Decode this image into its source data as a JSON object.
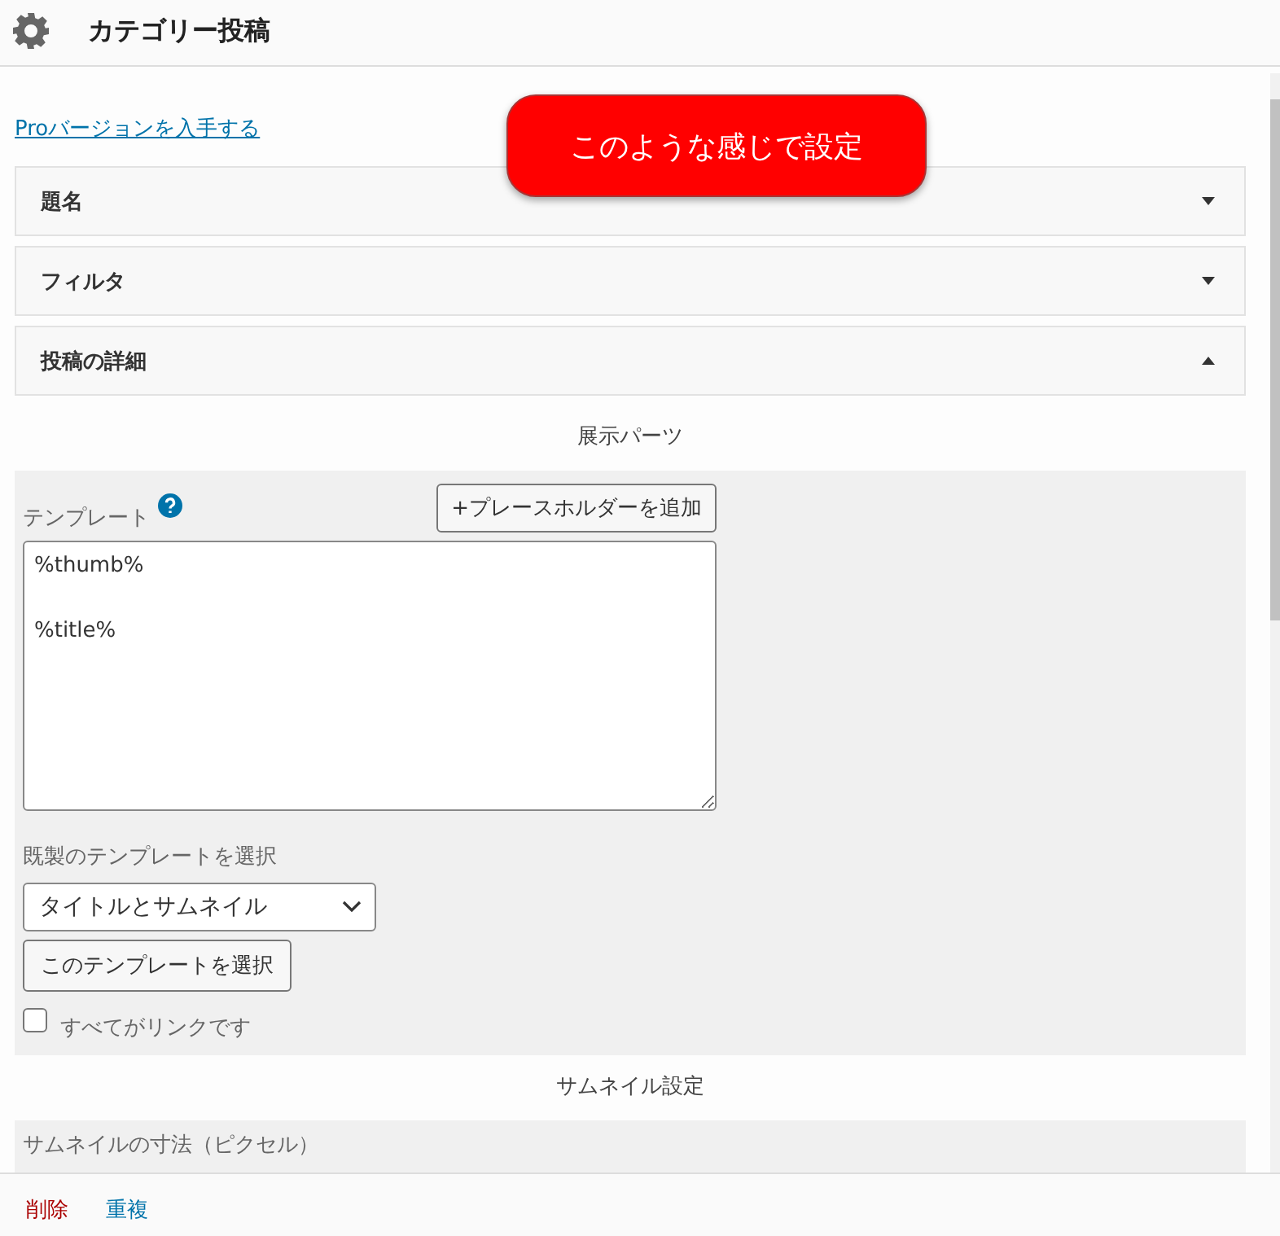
{
  "header": {
    "title": "カテゴリー投稿"
  },
  "pro_link": "Proバージョンを入手する",
  "callout": "このような感じで設定",
  "sections": [
    {
      "title": "題名",
      "expanded": false
    },
    {
      "title": "フィルタ",
      "expanded": false
    },
    {
      "title": "投稿の詳細",
      "expanded": true
    }
  ],
  "display_parts": {
    "heading": "展示パーツ",
    "template_label": "テンプレート",
    "add_placeholder_button": "+プレースホルダーを追加",
    "template_value": "%thumb%\n\n%title%",
    "preset_label": "既製のテンプレートを選択",
    "preset_select": "タイトルとサムネイル",
    "select_button": "このテンプレートを選択",
    "link_all": {
      "label": "すべてがリンクです",
      "checked": false
    }
  },
  "thumbnail": {
    "heading": "サムネイル設定",
    "size_label": "サムネイルの寸法（ピクセル）"
  },
  "footer": {
    "delete": "削除",
    "duplicate": "重複"
  }
}
